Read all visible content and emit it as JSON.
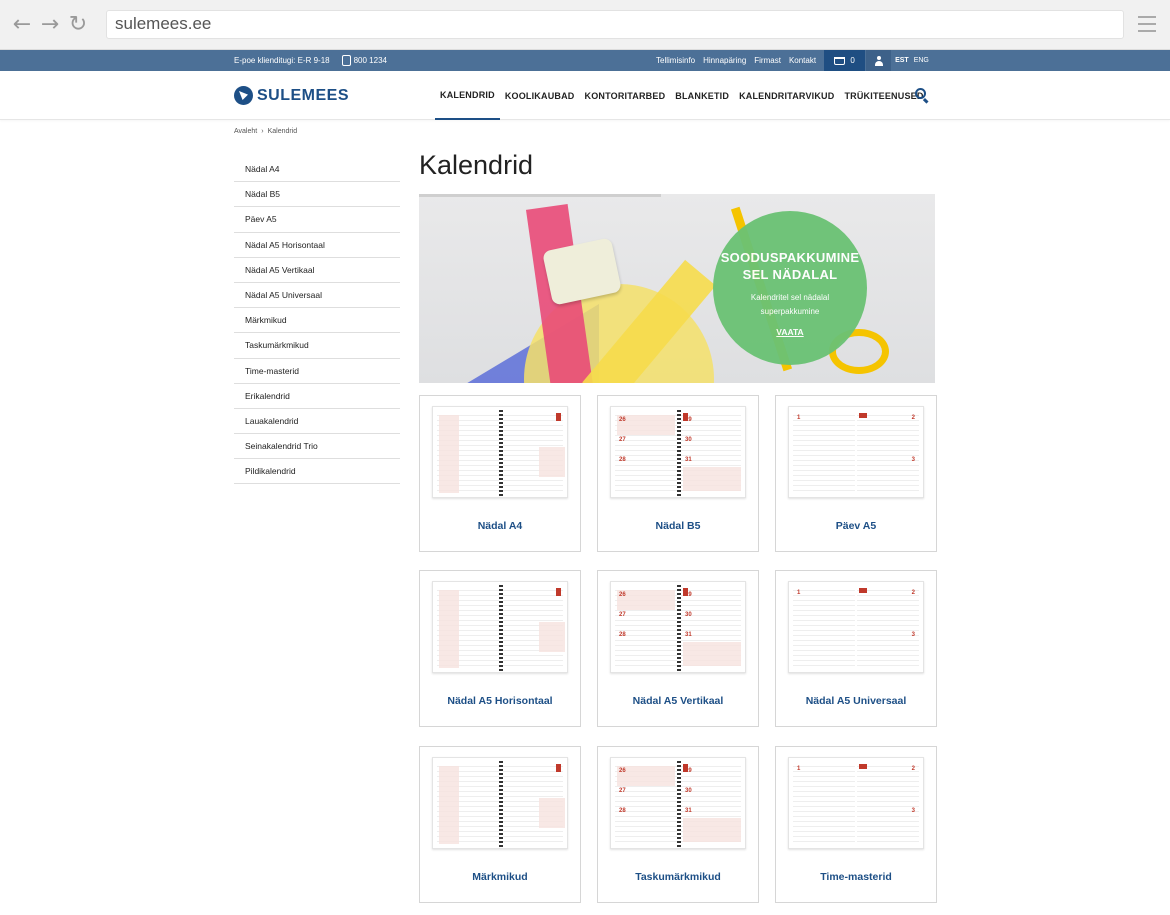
{
  "browser": {
    "url": "sulemees.ee"
  },
  "topbar": {
    "support_text": "E-poe klienditugi: E-R 9-18",
    "phone": "800 1234",
    "links": [
      "Tellimisinfo",
      "Hinnapäring",
      "Firmast",
      "Kontakt"
    ],
    "cart_count": "0",
    "languages": [
      "EST",
      "ENG"
    ],
    "active_language": "EST"
  },
  "header": {
    "logo_text": "SULEMEES",
    "nav": [
      "KALENDRID",
      "KOOLIKAUBAD",
      "KONTORITARBED",
      "BLANKETID",
      "KALENDRITARVIKUD",
      "TRÜKITEENUSED"
    ],
    "active_nav": "KALENDRID"
  },
  "breadcrumb": {
    "home": "Avaleht",
    "separator": "›",
    "current": "Kalendrid"
  },
  "sidebar": {
    "items": [
      "Nädal A4",
      "Nädal B5",
      "Päev A5",
      "Nädal A5 Horisontaal",
      "Nädal A5 Vertikaal",
      "Nädal A5 Universaal",
      "Märkmikud",
      "Taskumärkmikud",
      "Time-masterid",
      "Erikalendrid",
      "Lauakalendrid",
      "Seinakalendrid Trio",
      "Pildikalendrid"
    ]
  },
  "page": {
    "title": "Kalendrid"
  },
  "banner": {
    "title_line1": "SOODUSPAKKUMINE",
    "title_line2": "SEL NÄDALAL",
    "subtitle_line1": "Kalendritel sel nädalal",
    "subtitle_line2": "superpakkumine",
    "link": "VAATA",
    "circle_color": "#6ac274"
  },
  "products": [
    {
      "title": "Nädal A4",
      "style": "weekly-a4"
    },
    {
      "title": "Nädal B5",
      "style": "weekly-b5"
    },
    {
      "title": "Päev A5",
      "style": "daily"
    },
    {
      "title": "Nädal A5 Horisontaal",
      "style": "weekly-a4"
    },
    {
      "title": "Nädal A5 Vertikaal",
      "style": "weekly-b5"
    },
    {
      "title": "Nädal A5 Universaal",
      "style": "daily"
    },
    {
      "title": "Märkmikud",
      "style": "weekly-a4"
    },
    {
      "title": "Taskumärkmikud",
      "style": "weekly-b5"
    },
    {
      "title": "Time-masterid",
      "style": "daily"
    }
  ],
  "colors": {
    "brand": "#1d4f86",
    "topbar": "#4c7097",
    "accent_red": "#c0392b"
  }
}
